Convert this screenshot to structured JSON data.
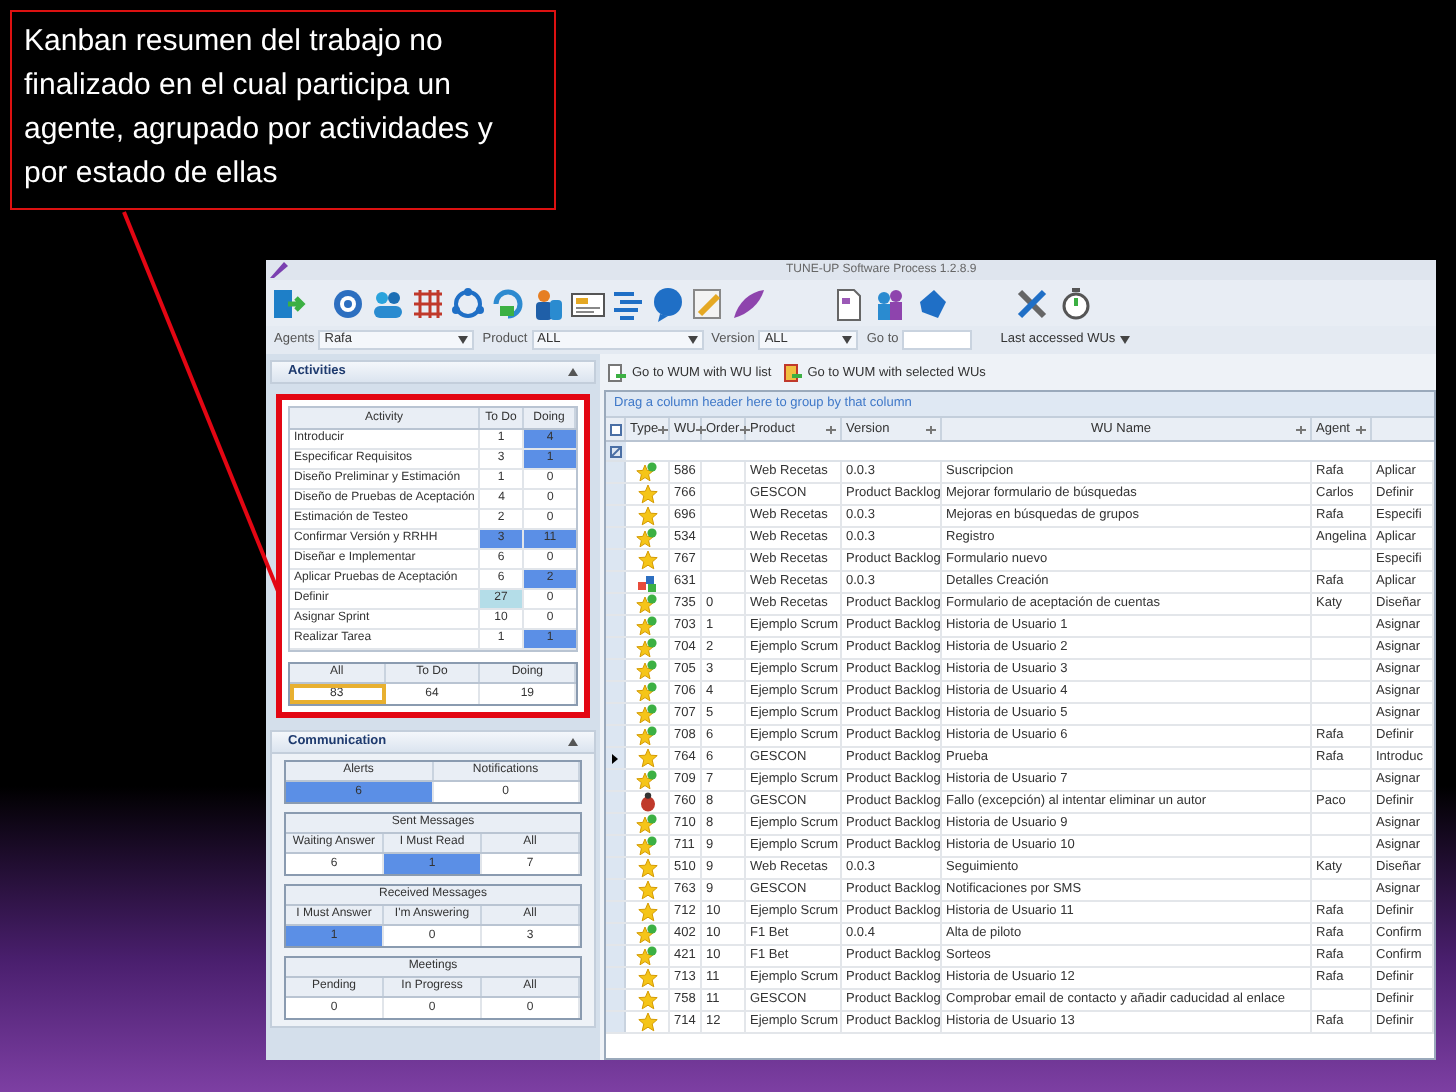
{
  "annotation": "Kanban resumen del trabajo no finalizado en el cual participa un agente, agrupado por actividades y por estado de ellas",
  "window": {
    "title": "TUNE-UP Software Process 1.2.8.9"
  },
  "filters": {
    "agents_label": "Agents",
    "agent": "Rafa",
    "product_label": "Product",
    "product": "ALL",
    "version_label": "Version",
    "version": "ALL",
    "goto_label": "Go to",
    "last_accessed": "Last accessed WUs"
  },
  "activities": {
    "title": "Activities",
    "columns": [
      "Activity",
      "To Do",
      "Doing"
    ],
    "rows": [
      {
        "name": "Introducir",
        "todo": "1",
        "doing": "4",
        "todo_selected": false,
        "todo_focused": false,
        "doing_selected": true
      },
      {
        "name": "Especificar Requisitos",
        "todo": "3",
        "doing": "1",
        "todo_selected": false,
        "todo_focused": false,
        "doing_selected": true
      },
      {
        "name": "Diseño Preliminar y Estimación",
        "todo": "1",
        "doing": "0",
        "todo_selected": false,
        "todo_focused": false,
        "doing_selected": false
      },
      {
        "name": "Diseño de Pruebas de Aceptación",
        "todo": "4",
        "doing": "0",
        "todo_selected": false,
        "todo_focused": false,
        "doing_selected": false
      },
      {
        "name": "Estimación de Testeo",
        "todo": "2",
        "doing": "0",
        "todo_selected": false,
        "todo_focused": false,
        "doing_selected": false
      },
      {
        "name": "Confirmar Versión y RRHH",
        "todo": "3",
        "doing": "11",
        "todo_selected": true,
        "todo_focused": false,
        "doing_selected": true
      },
      {
        "name": "Diseñar e Implementar",
        "todo": "6",
        "doing": "0",
        "todo_selected": false,
        "todo_focused": false,
        "doing_selected": false
      },
      {
        "name": "Aplicar Pruebas de Aceptación",
        "todo": "6",
        "doing": "2",
        "todo_selected": false,
        "todo_focused": false,
        "doing_selected": true
      },
      {
        "name": "Definir",
        "todo": "27",
        "doing": "0",
        "todo_selected": false,
        "todo_focused": true,
        "doing_selected": false
      },
      {
        "name": "Asignar Sprint",
        "todo": "10",
        "doing": "0",
        "todo_selected": false,
        "todo_focused": false,
        "doing_selected": false
      },
      {
        "name": "Realizar Tarea",
        "todo": "1",
        "doing": "1",
        "todo_selected": false,
        "todo_focused": false,
        "doing_selected": true
      }
    ],
    "totals": {
      "columns": [
        "All",
        "To Do",
        "Doing"
      ],
      "values": [
        {
          "text": "83",
          "selected": true
        },
        {
          "text": "64",
          "selected": false
        },
        {
          "text": "19",
          "selected": false
        }
      ]
    }
  },
  "communication": {
    "title": "Communication",
    "groups": [
      {
        "columns": [
          "Alerts",
          "Notifications"
        ],
        "values": [
          {
            "text": "6",
            "selected": true
          },
          {
            "text": "0",
            "selected": false
          }
        ]
      },
      {
        "title": "Sent Messages",
        "columns": [
          "Waiting Answer",
          "I Must Read",
          "All"
        ],
        "values": [
          {
            "text": "6",
            "selected": false
          },
          {
            "text": "1",
            "selected": true
          },
          {
            "text": "7",
            "selected": false
          }
        ]
      },
      {
        "title": "Received Messages",
        "columns": [
          "I Must Answer",
          "I'm Answering",
          "All"
        ],
        "values": [
          {
            "text": "1",
            "selected": true
          },
          {
            "text": "0",
            "selected": false
          },
          {
            "text": "3",
            "selected": false
          }
        ]
      },
      {
        "title": "Meetings",
        "columns": [
          "Pending",
          "In Progress",
          "All"
        ],
        "values": [
          {
            "text": "0",
            "selected": false
          },
          {
            "text": "0",
            "selected": false
          },
          {
            "text": "0",
            "selected": false
          }
        ]
      }
    ]
  },
  "wum_toolbar": [
    "Go to WUM with WU list",
    "Go to WUM with selected WUs"
  ],
  "grid": {
    "group_hint": "Drag a column header here to group by that column",
    "columns": [
      "Type",
      "WU",
      "Order",
      "Product",
      "Version",
      "WU Name",
      "Agent"
    ],
    "rows": [
      {
        "kind": "star_check",
        "wu": "586",
        "product": "Web Recetas",
        "version": "0.0.3",
        "name": "Suscripcion",
        "agent": "Rafa",
        "column_9": "Aplicar",
        "current": false
      },
      {
        "kind": "star",
        "wu": "766",
        "product": "GESCON",
        "version": "Product Backlog",
        "name": "Mejorar formulario de búsquedas",
        "agent": "Carlos",
        "column_9": "Definir",
        "current": false
      },
      {
        "kind": "star",
        "wu": "696",
        "product": "Web Recetas",
        "version": "0.0.3",
        "name": "Mejoras en búsquedas de grupos",
        "agent": "Rafa",
        "column_9": "Especifi",
        "current": false
      },
      {
        "kind": "star_check",
        "wu": "534",
        "product": "Web Recetas",
        "version": "0.0.3",
        "name": "Registro",
        "agent": "Angelina",
        "column_9": "Aplicar",
        "current": false
      },
      {
        "kind": "star",
        "wu": "767",
        "product": "Web Recetas",
        "version": "Product Backlog",
        "name": "Formulario nuevo",
        "column_9": "Especifi",
        "current": false
      },
      {
        "kind": "blocks",
        "wu": "631",
        "product": "Web Recetas",
        "version": "0.0.3",
        "name": "Detalles Creación",
        "agent": "Rafa",
        "column_9": "Aplicar",
        "current": false
      },
      {
        "kind": "star_check",
        "wu": "735",
        "order": "0",
        "product": "Web Recetas",
        "version": "Product Backlog",
        "name": "Formulario de aceptación de cuentas",
        "agent": "Katy",
        "column_9": "Diseñar",
        "current": false
      },
      {
        "kind": "star_check",
        "wu": "703",
        "order": "1",
        "product": "Ejemplo Scrum",
        "version": "Product Backlog",
        "name": "Historia de Usuario 1",
        "column_9": "Asignar",
        "current": false
      },
      {
        "kind": "star_check",
        "wu": "704",
        "order": "2",
        "product": "Ejemplo Scrum",
        "version": "Product Backlog",
        "name": "Historia de Usuario 2",
        "column_9": "Asignar",
        "current": false
      },
      {
        "kind": "star_check",
        "wu": "705",
        "order": "3",
        "product": "Ejemplo Scrum",
        "version": "Product Backlog",
        "name": "Historia de Usuario 3",
        "column_9": "Asignar",
        "current": false
      },
      {
        "kind": "star_check",
        "wu": "706",
        "order": "4",
        "product": "Ejemplo Scrum",
        "version": "Product Backlog",
        "name": "Historia de Usuario 4",
        "column_9": "Asignar",
        "current": false
      },
      {
        "kind": "star_check",
        "wu": "707",
        "order": "5",
        "product": "Ejemplo Scrum",
        "version": "Product Backlog",
        "name": "Historia de Usuario 5",
        "column_9": "Asignar",
        "current": false
      },
      {
        "kind": "star_check",
        "wu": "708",
        "order": "6",
        "product": "Ejemplo Scrum",
        "version": "Product Backlog",
        "name": "Historia de Usuario 6",
        "agent": "Rafa",
        "column_9": "Definir",
        "current": false
      },
      {
        "kind": "star",
        "wu": "764",
        "order": "6",
        "product": "GESCON",
        "version": "Product Backlog",
        "name": "Prueba",
        "agent": "Rafa",
        "column_9": "Introduc",
        "current": true
      },
      {
        "kind": "star_check",
        "wu": "709",
        "order": "7",
        "product": "Ejemplo Scrum",
        "version": "Product Backlog",
        "name": "Historia de Usuario 7",
        "column_9": "Asignar",
        "current": false
      },
      {
        "kind": "bug",
        "wu": "760",
        "order": "8",
        "product": "GESCON",
        "version": "Product Backlog",
        "name": "Fallo (excepción) al intentar eliminar un autor",
        "agent": "Paco",
        "column_9": "Definir",
        "current": false
      },
      {
        "kind": "star_check",
        "wu": "710",
        "order": "8",
        "product": "Ejemplo Scrum",
        "version": "Product Backlog",
        "name": "Historia de Usuario 9",
        "column_9": "Asignar",
        "current": false
      },
      {
        "kind": "star_check",
        "wu": "711",
        "order": "9",
        "product": "Ejemplo Scrum",
        "version": "Product Backlog",
        "name": "Historia de Usuario 10",
        "column_9": "Asignar",
        "current": false
      },
      {
        "kind": "star",
        "wu": "510",
        "order": "9",
        "product": "Web Recetas",
        "version": "0.0.3",
        "name": "Seguimiento",
        "agent": "Katy",
        "column_9": "Diseñar",
        "current": false
      },
      {
        "kind": "star",
        "wu": "763",
        "order": "9",
        "product": "GESCON",
        "version": "Product Backlog",
        "name": "Notificaciones por SMS",
        "column_9": "Asignar",
        "current": false
      },
      {
        "kind": "star",
        "wu": "712",
        "order": "10",
        "product": "Ejemplo Scrum",
        "version": "Product Backlog",
        "name": "Historia de Usuario 11",
        "agent": "Rafa",
        "column_9": "Definir",
        "current": false
      },
      {
        "kind": "star_check",
        "wu": "402",
        "order": "10",
        "product": "F1 Bet",
        "version": "0.0.4",
        "name": "Alta de piloto",
        "agent": "Rafa",
        "column_9": "Confirm",
        "current": false
      },
      {
        "kind": "star_check",
        "wu": "421",
        "order": "10",
        "product": "F1 Bet",
        "version": "Product Backlog",
        "name": "Sorteos",
        "agent": "Rafa",
        "column_9": "Confirm",
        "current": false
      },
      {
        "kind": "star",
        "wu": "713",
        "order": "11",
        "product": "Ejemplo Scrum",
        "version": "Product Backlog",
        "name": "Historia de Usuario 12",
        "agent": "Rafa",
        "column_9": "Definir",
        "current": false
      },
      {
        "kind": "star",
        "wu": "758",
        "order": "11",
        "product": "GESCON",
        "version": "Product Backlog",
        "name": "Comprobar email de contacto y añadir caducidad al enlace",
        "column_9": "Definir",
        "current": false
      },
      {
        "kind": "star",
        "wu": "714",
        "order": "12",
        "product": "Ejemplo Scrum",
        "version": "Product Backlog",
        "name": "Historia de Usuario 13",
        "agent": "Rafa",
        "column_9": "Definir",
        "current": false
      }
    ]
  }
}
